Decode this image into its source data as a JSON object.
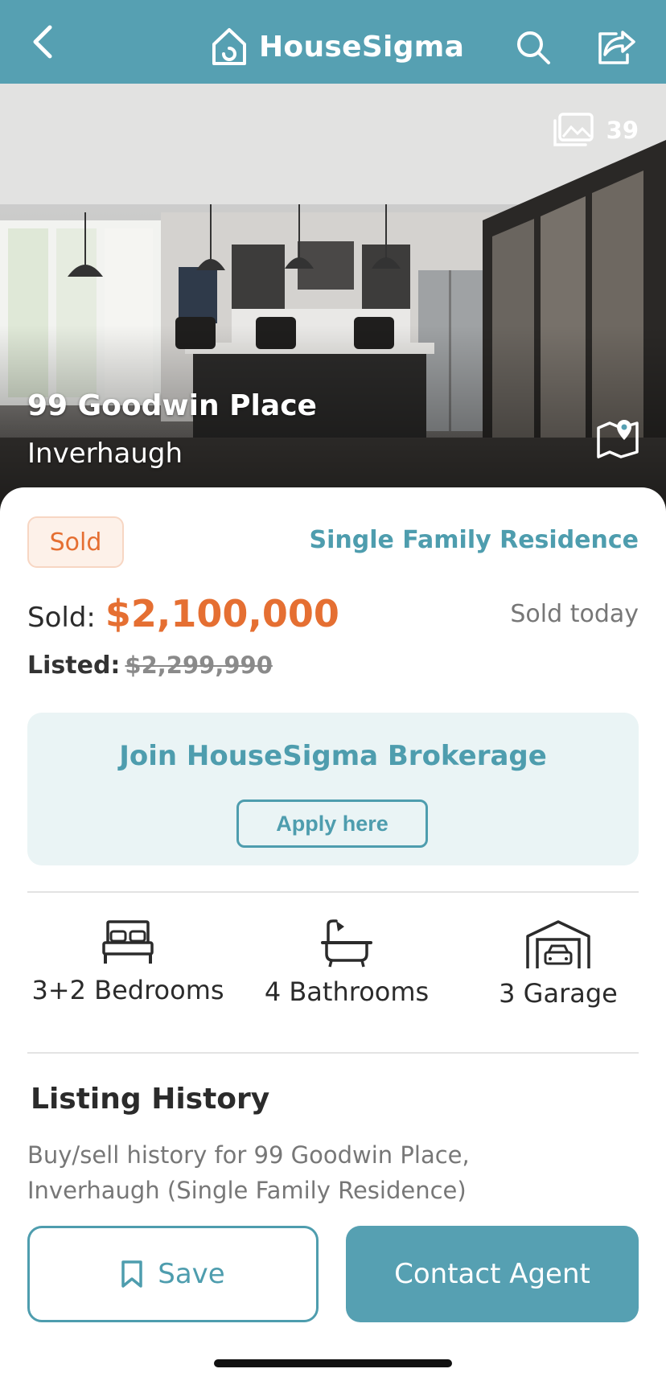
{
  "header": {
    "brand": "HouseSigma",
    "accent_color": "#56a0b2"
  },
  "hero": {
    "photo_count": "39",
    "address": "99 Goodwin Place",
    "city": "Inverhaugh"
  },
  "listing": {
    "status_badge": "Sold",
    "property_type": "Single Family Residence",
    "sold_label": "Sold:",
    "sold_price": "$2,100,000",
    "sold_date": "Sold today",
    "listed_label": "Listed:",
    "listed_price": "$2,299,990",
    "price_color": "#e56f32"
  },
  "promo": {
    "title": "Join HouseSigma Brokerage",
    "button": "Apply here"
  },
  "features": [
    {
      "icon": "bed-icon",
      "label": "3+2 Bedrooms"
    },
    {
      "icon": "bathtub-icon",
      "label": "4 Bathrooms"
    },
    {
      "icon": "garage-icon",
      "label": "3 Garage"
    }
  ],
  "history": {
    "title": "Listing History",
    "description": "Buy/sell history for 99 Goodwin Place, Inverhaugh (Single Family Residence)"
  },
  "actions": {
    "save_label": "Save",
    "contact_label": "Contact Agent"
  }
}
